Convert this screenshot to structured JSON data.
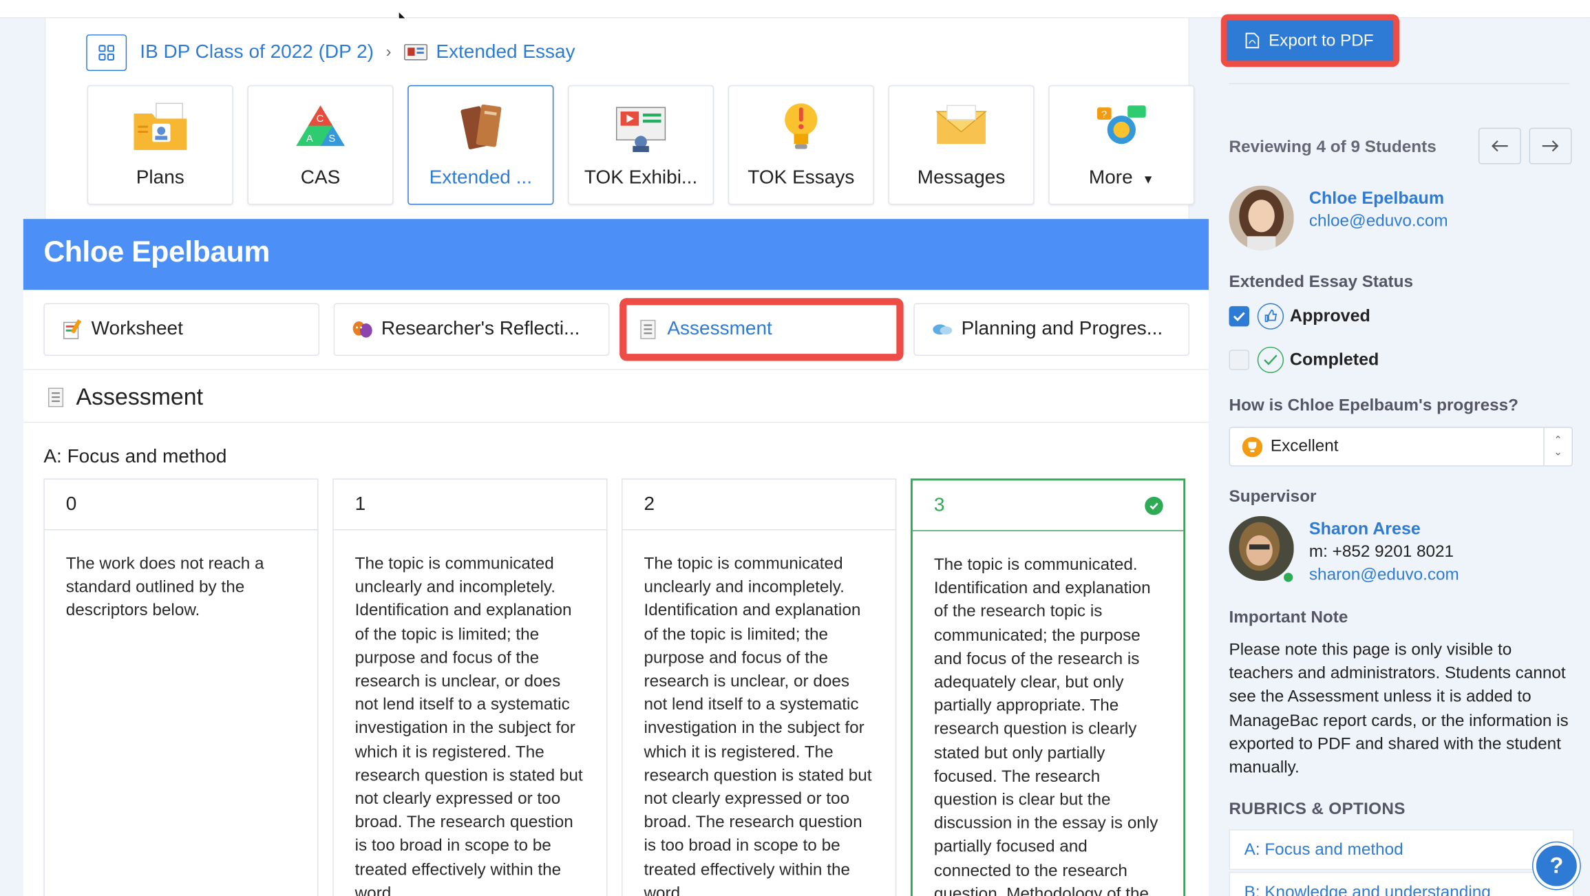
{
  "breadcrumb": {
    "class_name": "IB DP Class of 2022 (DP 2)",
    "current": "Extended Essay"
  },
  "app_tiles": [
    {
      "label": "Plans",
      "icon": "folder-icon"
    },
    {
      "label": "CAS",
      "icon": "cas-triangle-icon"
    },
    {
      "label": "Extended ...",
      "icon": "books-icon"
    },
    {
      "label": "TOK Exhibi...",
      "icon": "presentation-icon"
    },
    {
      "label": "TOK Essays",
      "icon": "lightbulb-icon"
    },
    {
      "label": "Messages",
      "icon": "envelope-icon"
    },
    {
      "label": "More",
      "icon": "chevron-down-icon"
    }
  ],
  "student_banner": {
    "name": "Chloe Epelbaum"
  },
  "sub_tabs": [
    {
      "label": "Worksheet"
    },
    {
      "label": "Researcher's Reflecti..."
    },
    {
      "label": "Assessment"
    },
    {
      "label": "Planning and Progres..."
    }
  ],
  "section": {
    "title": "Assessment"
  },
  "criterion": {
    "title": "A: Focus and method",
    "levels": [
      {
        "level": "0",
        "text": "The work does not reach a standard outlined by the descriptors below."
      },
      {
        "level": "1",
        "text": "The topic is communicated unclearly and incompletely. Identification and explanation of the topic is limited; the purpose and focus of the research is unclear, or does not lend itself to a systematic investigation in the subject for which it is registered. The research question is stated but not clearly expressed or too broad. The research question is too broad in scope to be treated effectively within the word"
      },
      {
        "level": "2",
        "text": "The topic is communicated unclearly and incompletely. Identification and explanation of the topic is limited; the purpose and focus of the research is unclear, or does not lend itself to a systematic investigation in the subject for which it is registered. The research question is stated but not clearly expressed or too broad. The research question is too broad in scope to be treated effectively within the word"
      },
      {
        "level": "3",
        "text": "The topic is communicated. Identification and explanation of the research topic is communicated; the purpose and focus of the research is adequately clear, but only partially appropriate. The research question is clearly stated but only partially focused. The research question is clear but the discussion in the essay is only partially focused and connected to the research question. Methodology of the"
      }
    ]
  },
  "sidebar": {
    "export_label": "Export to PDF",
    "reviewing": "Reviewing 4 of 9 Students",
    "student": {
      "name": "Chloe Epelbaum",
      "email": "chloe@eduvo.com"
    },
    "status_label": "Extended Essay Status",
    "approved_label": "Approved",
    "completed_label": "Completed",
    "progress_question": "How is Chloe Epelbaum's progress?",
    "progress_value": "Excellent",
    "supervisor_label": "Supervisor",
    "supervisor": {
      "name": "Sharon Arese",
      "phone": "m: +852 9201 8021",
      "email": "sharon@eduvo.com"
    },
    "note_label": "Important Note",
    "note_text": "Please note this page is only visible to teachers and administrators. Students cannot see the Assessment unless it is added to ManageBac report cards, or the information is exported to PDF and shared with the student manually.",
    "rubrics_label": "RUBRICS & OPTIONS",
    "rubrics": [
      {
        "label": "A: Focus and method"
      },
      {
        "label": "B: Knowledge and understanding"
      }
    ],
    "help_label": "?"
  },
  "colors": {
    "accent": "#2e7bd6",
    "banner": "#4b8ff7",
    "highlight": "#ee4d45",
    "selected": "#2faa55"
  }
}
